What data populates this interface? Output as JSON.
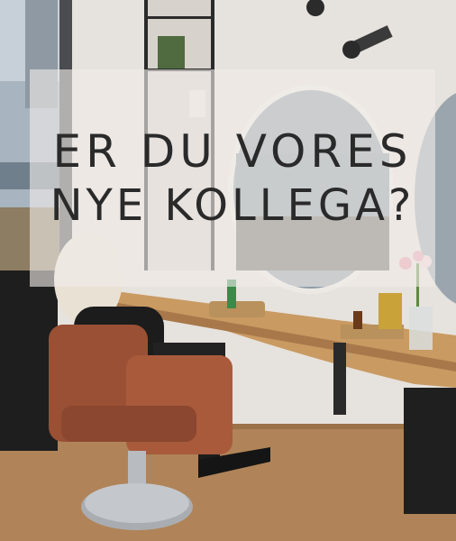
{
  "headline": {
    "line1": "ER DU VORES",
    "line2": "NYE KOLLEGA?"
  },
  "colors": {
    "overlay": "#f0ece8",
    "text": "#2a2a2a",
    "chair": "#9a5034",
    "counter": "#c99a62",
    "wall": "#e6e2dd",
    "floor": "#b08458"
  }
}
